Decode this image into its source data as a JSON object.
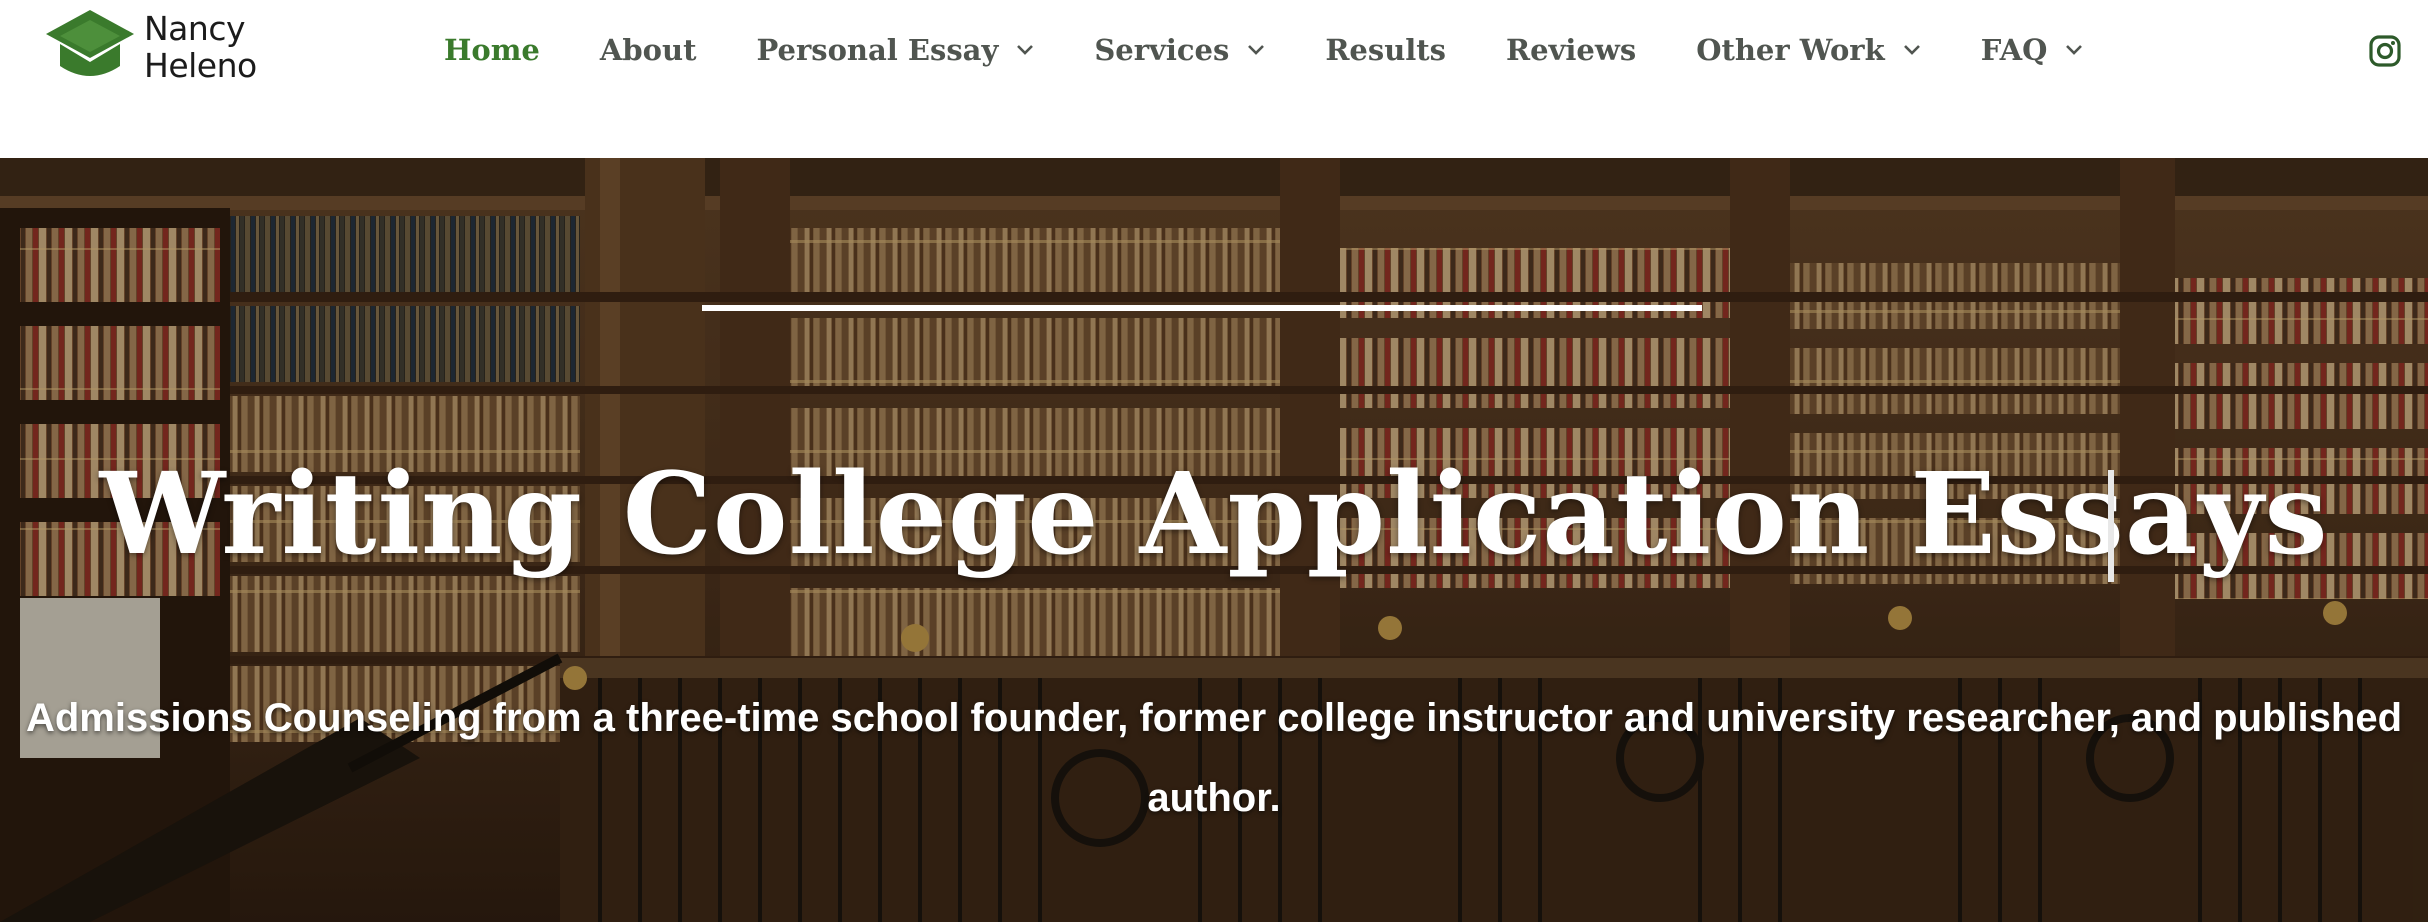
{
  "logo": {
    "line1": "Nancy",
    "line2": "Heleno"
  },
  "nav": {
    "items": [
      {
        "label": "Home",
        "active": true,
        "dropdown": false
      },
      {
        "label": "About",
        "active": false,
        "dropdown": false
      },
      {
        "label": "Personal Essay",
        "active": false,
        "dropdown": true
      },
      {
        "label": "Services",
        "active": false,
        "dropdown": true
      },
      {
        "label": "Results",
        "active": false,
        "dropdown": false
      },
      {
        "label": "Reviews",
        "active": false,
        "dropdown": false
      },
      {
        "label": "Other Work",
        "active": false,
        "dropdown": true
      },
      {
        "label": "FAQ",
        "active": false,
        "dropdown": true
      }
    ],
    "social_icon": "instagram-icon"
  },
  "hero": {
    "title": "Writing College Application Essays",
    "subtitle_line1": "Admissions Counseling from a three-time school founder, former college instructor and university researcher, and published",
    "subtitle_line2": "author."
  },
  "colors": {
    "brand_green": "#3a7a2c",
    "nav_text": "#505550",
    "hero_text": "#ffffff"
  }
}
